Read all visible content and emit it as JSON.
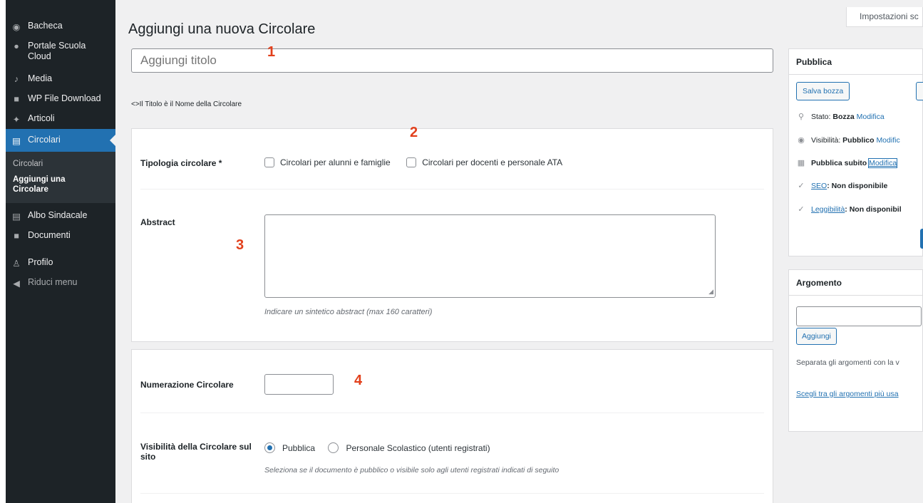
{
  "sidebar": {
    "items": [
      {
        "label": "Bacheca"
      },
      {
        "label": "Portale Scuola Cloud"
      },
      {
        "label": "Media"
      },
      {
        "label": "WP File Download"
      },
      {
        "label": "Articoli"
      },
      {
        "label": "Circolari"
      },
      {
        "label": "Albo Sindacale"
      },
      {
        "label": "Documenti"
      },
      {
        "label": "Profilo"
      },
      {
        "label": "Riduci menu"
      }
    ],
    "submenu": [
      "Circolari",
      "Aggiungi una Circolare"
    ]
  },
  "header": {
    "title": "Aggiungi una nuova Circolare",
    "screen_options": "Impostazioni sc"
  },
  "title_field": {
    "placeholder": "Aggiungi titolo"
  },
  "title_hint": "<>Il Titolo è il Nome della Circolare",
  "callouts": [
    "1",
    "2",
    "3",
    "4"
  ],
  "box1": {
    "tipologia_label": "Tipologia circolare *",
    "tipologia_options": [
      "Circolari per alunni e famiglie",
      "Circolari per docenti e personale ATA"
    ],
    "abstract_label": "Abstract",
    "abstract_desc": "Indicare un sintetico abstract (max 160 caratteri)"
  },
  "box2": {
    "numerazione_label": "Numerazione Circolare",
    "visibilita_label": "Visibilità della Circolare sul sito",
    "visibilita_options": [
      "Pubblica",
      "Personale Scolastico (utenti registrati)"
    ],
    "visibilita_selected": "Pubblica",
    "visibilita_desc": "Seleziona se il documento è pubblico o visibile solo agli utenti registrati indicati di seguito"
  },
  "publish": {
    "title": "Pubblica",
    "save_draft": "Salva bozza",
    "status_label": "Stato:",
    "status_value": "Bozza",
    "visibility_label": "Visibilità:",
    "visibility_value": "Pubblico",
    "schedule_label": "Pubblica subito",
    "edit_link": "Modifica",
    "visibility_edit": "Modific",
    "seo_link": "SEO",
    "seo_value": ": Non disponibile",
    "readability_link": "Leggibilità",
    "readability_value": ": Non disponibil"
  },
  "argomento": {
    "title": "Argomento",
    "add_button": "Aggiungi",
    "separator_hint": "Separata gli argomenti con la v",
    "popular_link": "Scegli tra gli argomenti più usa"
  },
  "colors": {
    "accent": "#2271b1",
    "sidebar": "#1d2327",
    "callout": "#e2401c"
  }
}
